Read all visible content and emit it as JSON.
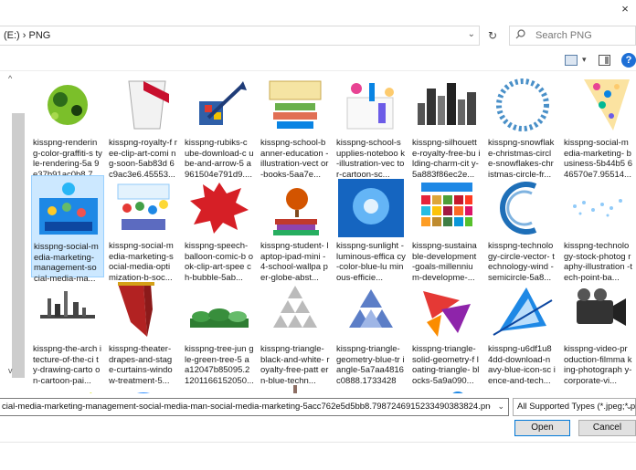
{
  "titlebar": {
    "close_glyph": "×"
  },
  "address": {
    "path": "(E:)  ›  PNG",
    "dropdown_glyph": "⌄"
  },
  "refresh_glyph": "↻",
  "search": {
    "placeholder": "Search PNG",
    "icon": "search-icon"
  },
  "toolbar": {
    "view_dropdown_glyph": "▾",
    "help_glyph": "?"
  },
  "left_scroll": {
    "up_glyph": "^",
    "down_glyph": "v"
  },
  "files": [
    {
      "name": "kisspng-renderin g-color-graffiti-s tyle-rendering-5a 9e37b91ac0b8.7...",
      "thumb": "graffiti",
      "selected": false
    },
    {
      "name": "kisspng-royalty-f ree-clip-art-comi ng-soon-5ab83d 6c9ac3e6.45553...",
      "thumb": "coming-soon",
      "selected": false
    },
    {
      "name": "kisspng-rubiks-c ube-download-c ube-and-arrow-5 a961504e791d9....",
      "thumb": "cube-arrow",
      "selected": false
    },
    {
      "name": "kisspng-school-b anner-education -illustration-vect or-books-5aa7e...",
      "thumb": "school-banner",
      "selected": false
    },
    {
      "name": "kisspng-school-s upplies-noteboo k-illustration-vec tor-cartoon-sc...",
      "thumb": "school-supplies",
      "selected": false
    },
    {
      "name": "kisspng-silhouett e-royalty-free-bu ilding-charm-cit y-5a883f86ec2e...",
      "thumb": "city-silhouette",
      "selected": false
    },
    {
      "name": "kisspng-snowflak e-christmas-circl e-snowflakes-chr istmas-circle-fr...",
      "thumb": "snowflake-circle",
      "selected": false
    },
    {
      "name": "kisspng-social-m edia-marketing- business-5b44b5 646570e7.95514...",
      "thumb": "social-business",
      "selected": false
    },
    {
      "name": "kisspng-social-m edia-marketing- management-so cial-media-ma...",
      "thumb": "social-media",
      "selected": true
    },
    {
      "name": "kisspng-social-m edia-marketing-s ocial-media-opti mization-b-soc...",
      "thumb": "social-optimization",
      "selected": false
    },
    {
      "name": "kisspng-speech- balloon-comic-b ook-clip-art-spee ch-bubble-5ab...",
      "thumb": "speech-bubble",
      "selected": false
    },
    {
      "name": "kisspng-student- laptop-ipad-mini -4-school-wallpa per-globe-abst...",
      "thumb": "student-globe",
      "selected": false
    },
    {
      "name": "kisspng-sunlight -luminous-effica cy-color-blue-lu minous-efficie...",
      "thumb": "sunlight",
      "selected": false
    },
    {
      "name": "kisspng-sustaina ble-development -goals-millenniu m-developme-...",
      "thumb": "sdg-goals",
      "selected": false
    },
    {
      "name": "kisspng-technolo gy-circle-vector- technology-wind -semicircle-5a8...",
      "thumb": "tech-circle",
      "selected": false
    },
    {
      "name": "kisspng-technolo gy-stock-photog raphy-illustration -tech-point-ba...",
      "thumb": "tech-points",
      "selected": false
    },
    {
      "name": "kisspng-the-arch itecture-of-the-ci ty-drawing-carto on-cartoon-pai...",
      "thumb": "architecture",
      "selected": false
    },
    {
      "name": "kisspng-theater- drapes-and-stag e-curtains-windo w-treatment-5...",
      "thumb": "curtains",
      "selected": false
    },
    {
      "name": "kisspng-tree-jun gle-green-tree-5 aa12047b85095.2 1201166152050...",
      "thumb": "tree-jungle",
      "selected": false
    },
    {
      "name": "kisspng-triangle- black-and-white- royalty-free-patt ern-blue-techn...",
      "thumb": "triangle-bw",
      "selected": false
    },
    {
      "name": "kisspng-triangle- geometry-blue-tr iangle-5a7aa4816 c0888.17334287...",
      "thumb": "triangle-blue",
      "selected": false
    },
    {
      "name": "kisspng-triangle- solid-geometry-f loating-triangle- blocks-5a9a090...",
      "thumb": "triangle-solid",
      "selected": false
    },
    {
      "name": "kisspng-u6df1u8 4dd-download-n avy-blue-icon-sc ience-and-tech...",
      "thumb": "blue-tech",
      "selected": false
    },
    {
      "name": "kisspng-video-pr oduction-filmma king-photograph y-corporate-vi...",
      "thumb": "video-production",
      "selected": false
    },
    {
      "name": "",
      "thumb": "yellow-splash",
      "selected": false
    },
    {
      "name": "",
      "thumb": "zoom-icon",
      "selected": false
    },
    {
      "name": "",
      "thumb": "contact-us",
      "selected": false
    },
    {
      "name": "",
      "thumb": "lantern",
      "selected": false
    },
    {
      "name": "",
      "thumb": "servers",
      "selected": false
    },
    {
      "name": "",
      "thumb": "map-pins",
      "selected": false
    },
    {
      "name": "",
      "thumb": "bell-signal",
      "selected": false
    },
    {
      "name": "",
      "thumb": "mosque",
      "selected": false
    }
  ],
  "filename": {
    "value": "cial-media-marketing-management-social-media-man-social-media-marketing-5acc762e5d5bb8.7987246915233490383824.png",
    "dropdown_glyph": "⌄"
  },
  "filetype": {
    "value": "All Supported Types (*.jpeg;*.pr",
    "dropdown_glyph": "⌄"
  },
  "buttons": {
    "open": "Open",
    "cancel": "Cancel"
  }
}
